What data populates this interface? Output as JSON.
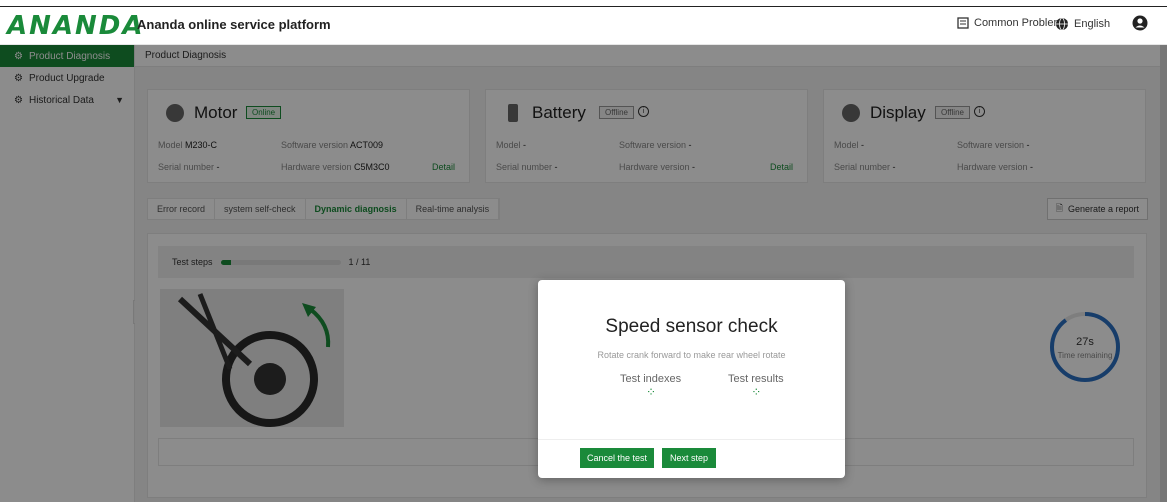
{
  "header": {
    "logo": "ANANDA",
    "title": "Ananda online service platform",
    "common_problems": "Common Problems",
    "language": "English"
  },
  "sidebar": {
    "items": [
      {
        "label": "Product Diagnosis"
      },
      {
        "label": "Product Upgrade"
      },
      {
        "label": "Historical Data"
      }
    ]
  },
  "breadcrumb": "Product Diagnosis",
  "devices": {
    "motor": {
      "name": "Motor",
      "status": "Online",
      "model_label": "Model",
      "model": "M230-C",
      "sw_label": "Software version",
      "sw": "ACT009",
      "serial_label": "Serial number",
      "serial": "-",
      "hw_label": "Hardware version",
      "hw": "C5M3C0",
      "detail": "Detail"
    },
    "battery": {
      "name": "Battery",
      "status": "Offline",
      "model_label": "Model",
      "model": "-",
      "sw_label": "Software version",
      "sw": "-",
      "serial_label": "Serial number",
      "serial": "-",
      "hw_label": "Hardware version",
      "hw": "-",
      "detail": "Detail"
    },
    "display": {
      "name": "Display",
      "status": "Offline",
      "model_label": "Model",
      "model": "-",
      "sw_label": "Software version",
      "sw": "-",
      "serial_label": "Serial number",
      "serial": "-",
      "hw_label": "Hardware version",
      "hw": "-"
    }
  },
  "tabs": [
    "Error record",
    "system self-check",
    "Dynamic diagnosis",
    "Real-time analysis"
  ],
  "report_button": "Generate a report",
  "test": {
    "steps_label": "Test steps",
    "progress_fraction": 0.09,
    "steps_count": "1 / 11",
    "timer_value": "27s",
    "timer_label": "Time remaining",
    "timer_fraction": 0.9
  },
  "modal": {
    "title": "Speed sensor check",
    "description": "Rotate crank forward to make rear wheel rotate",
    "col1": "Test indexes",
    "col2": "Test results",
    "cancel": "Cancel the test",
    "next": "Next step"
  },
  "colors": {
    "accent": "#1a8a3a",
    "timer": "#2b6fc2"
  }
}
